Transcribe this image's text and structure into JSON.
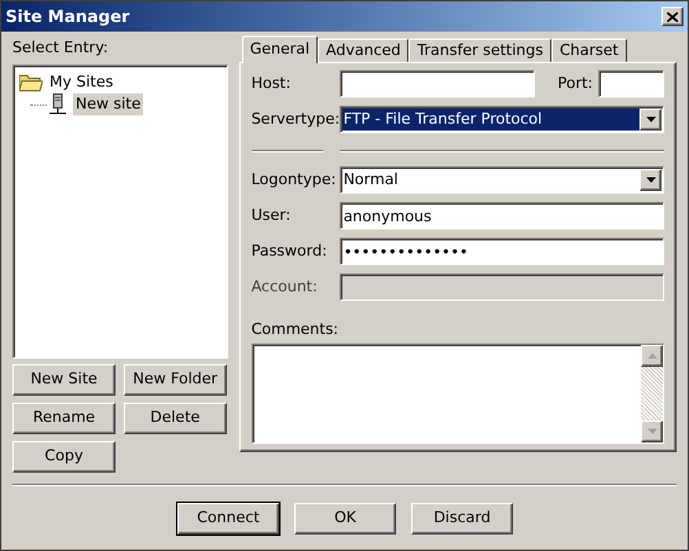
{
  "window": {
    "title": "Site Manager"
  },
  "select_label": "Select Entry:",
  "tree": [
    {
      "label": "My Sites",
      "kind": "folder",
      "selected": false,
      "children": [
        {
          "label": "New site",
          "kind": "site",
          "selected": true
        }
      ]
    }
  ],
  "left_buttons": [
    "New Site",
    "New Folder",
    "Rename",
    "Delete",
    "Copy"
  ],
  "tabs": [
    {
      "label": "General",
      "selected": true
    },
    {
      "label": "Advanced",
      "selected": false
    },
    {
      "label": "Transfer settings",
      "selected": false
    },
    {
      "label": "Charset",
      "selected": false
    }
  ],
  "host": {
    "label": "Host:"
  },
  "port": {
    "label": "Port:"
  },
  "servertype": {
    "label": "Servertype:",
    "value": "FTP - File Transfer Protocol",
    "highlighted": true
  },
  "fields": [
    {
      "label": "Logontype:",
      "kind": "select",
      "value": "Normal",
      "disabled": false
    },
    {
      "label": "User:",
      "kind": "text",
      "value": "anonymous",
      "disabled": false
    },
    {
      "label": "Password:",
      "kind": "text",
      "value": "••••••••••••••",
      "disabled": false
    },
    {
      "label": "Account:",
      "kind": "text",
      "disabled": true
    }
  ],
  "comments": {
    "label": "Comments:"
  },
  "buttons": [
    {
      "label": "Connect",
      "default": true
    },
    {
      "label": "OK",
      "default": false
    },
    {
      "label": "Discard",
      "default": false
    }
  ]
}
